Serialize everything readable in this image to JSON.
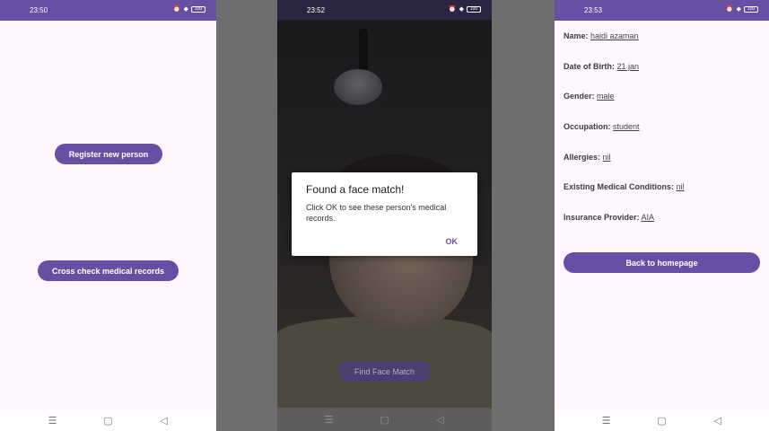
{
  "screen1": {
    "status_time": "23:50",
    "register_label": "Register new person",
    "crosscheck_label": "Cross check medical records"
  },
  "screen2": {
    "status_time": "23:52",
    "dialog": {
      "title": "Found a face match!",
      "message": "Click OK to see these person's medical records.",
      "ok_label": "OK"
    },
    "find_label": "Find Face Match"
  },
  "screen3": {
    "status_time": "23:53",
    "fields": [
      {
        "label": "Name:",
        "value": "haidi azaman"
      },
      {
        "label": "Date of Birth:",
        "value": "21 jan"
      },
      {
        "label": "Gender:",
        "value": "male"
      },
      {
        "label": "Occupation:",
        "value": "student"
      },
      {
        "label": "Allergies:",
        "value": "nil"
      },
      {
        "label": "Existing Medical Conditions:",
        "value": "nil"
      },
      {
        "label": "Insurance Provider:",
        "value": "AIA "
      }
    ],
    "back_label": "Back to homepage"
  },
  "status_icons": {
    "alarm": "⏰",
    "signal": "◆",
    "battery": "100"
  },
  "nav_icons": {
    "recents": "☰",
    "home": "▢",
    "back": "◁"
  },
  "colors": {
    "primary": "#6750a4",
    "background": "#fef7ff",
    "gap": "#6e6e6e"
  }
}
